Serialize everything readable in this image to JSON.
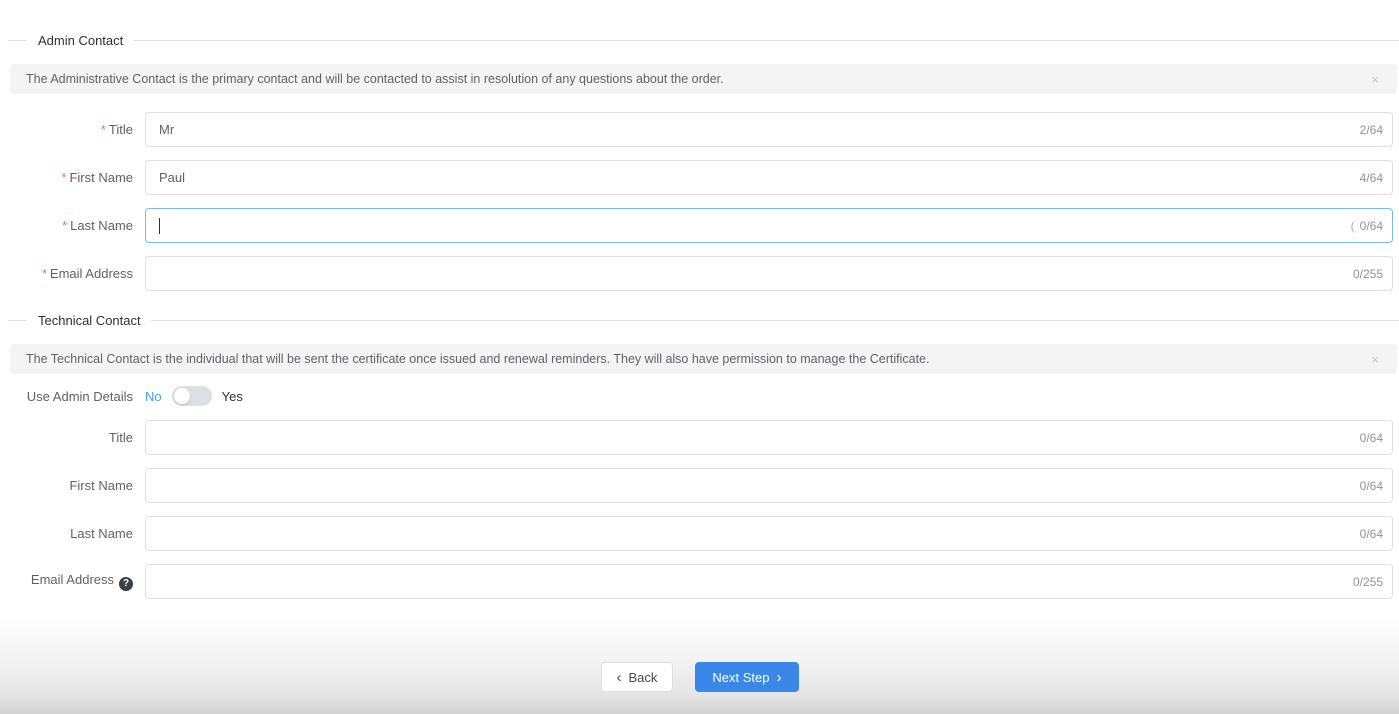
{
  "misc": {
    "required_marker": "*",
    "close_glyph": "×",
    "help_glyph": "?"
  },
  "admin_contact": {
    "section_title": "Admin Contact",
    "alert_text": "The Administrative Contact is the primary contact and will be contacted to assist in resolution of any questions about the order.",
    "fields": [
      {
        "label": "Title",
        "required": true,
        "value": "Mr",
        "counter": "2/64"
      },
      {
        "label": "First Name",
        "required": true,
        "value": "Paul",
        "counter": "4/64"
      },
      {
        "label": "Last Name",
        "required": true,
        "value": "",
        "counter": "0/64",
        "counter_prefix": "(",
        "focused": true
      },
      {
        "label": "Email Address",
        "required": true,
        "value": "",
        "counter": "0/255"
      }
    ]
  },
  "technical_contact": {
    "section_title": "Technical Contact",
    "alert_text": "The Technical Contact is the individual that will be sent the certificate once issued and renewal reminders. They will also have permission to manage the Certificate.",
    "use_admin_details": {
      "label": "Use Admin Details",
      "off_label": "No",
      "on_label": "Yes",
      "state": "off"
    },
    "fields": [
      {
        "label": "Title",
        "required": false,
        "value": "",
        "counter": "0/64"
      },
      {
        "label": "First Name",
        "required": false,
        "value": "",
        "counter": "0/64"
      },
      {
        "label": "Last Name",
        "required": false,
        "value": "",
        "counter": "0/64"
      },
      {
        "label": "Email Address",
        "required": false,
        "value": "",
        "counter": "0/255",
        "has_help": true
      }
    ]
  },
  "footer": {
    "back_label": "Back",
    "back_chevron": "‹",
    "next_label": "Next Step",
    "next_chevron": "›"
  },
  "colors": {
    "accent_blue": "#3a87e8",
    "toggle_active_text": "#409eff",
    "alert_bg": "#f4f4f5",
    "required_red": "#f56c6c",
    "focus_border": "#7db9f2"
  }
}
